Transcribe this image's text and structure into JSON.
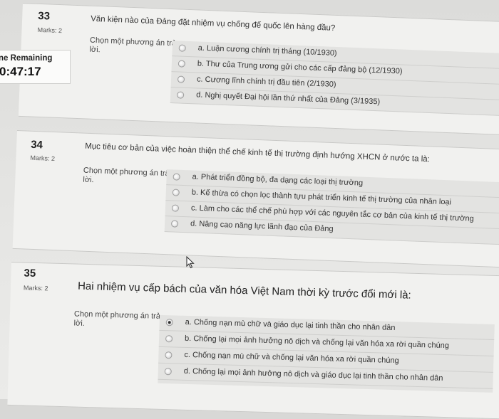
{
  "timer": {
    "label": "ne Remaining",
    "value": "0:47:17"
  },
  "questions": [
    {
      "number": "33",
      "marks": "Marks: 2",
      "text": "Văn kiện nào của Đảng đặt nhiệm vụ chống đế quốc lên hàng đầu?",
      "prompt": "Chọn một phương án trả lời.",
      "options": [
        "a. Luận cương chính trị tháng (10/1930)",
        "b. Thư của Trung ương gửi cho các cấp đảng bộ (12/1930)",
        "c. Cương lĩnh chính trị đầu tiên (2/1930)",
        "d. Nghị quyết Đại hội lần thứ nhất của Đảng (3/1935)"
      ],
      "selected": -1
    },
    {
      "number": "34",
      "marks": "Marks: 2",
      "text": "Mục tiêu cơ bản của việc hoàn thiện thể chế kinh tế thị trường định hướng XHCN ở nước ta là:",
      "prompt": "Chọn một phương án trả lời.",
      "options": [
        "a. Phát triển đồng bộ, đa dạng các loại thị trường",
        "b. Kế thừa có chọn lọc thành tựu phát triển kinh tế thị trường của nhân loại",
        "c. Làm cho các thể chế phù hợp với các nguyên tắc cơ bản của kinh tế thị trường",
        "d. Nâng cao năng lực lãnh đạo của Đảng"
      ],
      "selected": -1
    },
    {
      "number": "35",
      "marks": "Marks: 2",
      "text": "Hai nhiệm vụ cấp bách của văn hóa Việt Nam thời kỳ trước đổi mới là:",
      "prompt": "Chọn một phương án trả lời.",
      "options": [
        "a. Chống nạn mù chữ và giáo dục lại tinh thần cho nhân dân",
        "b. Chống lại mọi ảnh hưởng nô dịch và chống lại văn hóa xa rời quần chúng",
        "c. Chống nạn mù chữ và chống lại văn hóa xa rời quần chúng",
        "d. Chống lại mọi ảnh hưởng nô dịch và giáo dục lại tinh thần cho nhân dân"
      ],
      "selected": 0
    }
  ]
}
